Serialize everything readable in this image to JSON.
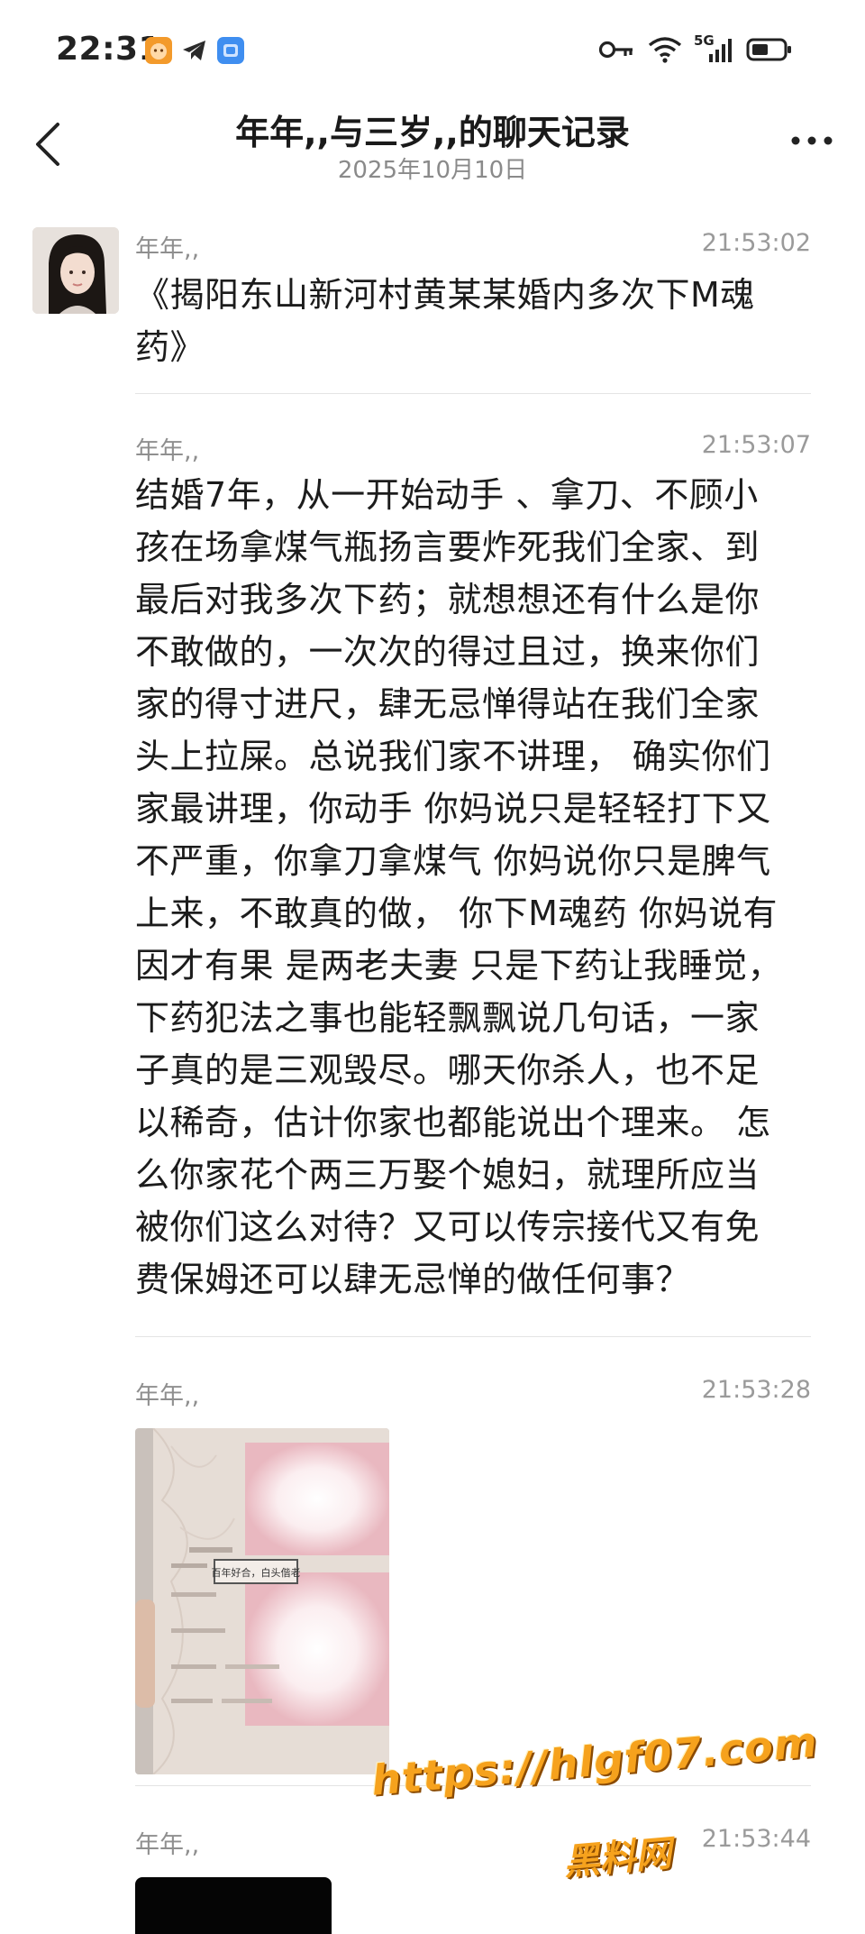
{
  "status_bar": {
    "time": "22:31",
    "notification_icons": [
      "cat-app-icon",
      "telegram-icon",
      "blue-app-icon"
    ],
    "system_icons": [
      "key-icon",
      "wifi-icon",
      "signal-5g-icon",
      "battery-icon"
    ],
    "network_label": "5G"
  },
  "header": {
    "title": "年年,,与三岁,,的聊天记录",
    "date": "2025年10月10日",
    "back_icon": "chevron-left-icon",
    "more_icon": "more-dots-icon"
  },
  "messages": [
    {
      "sender": "年年,,",
      "time": "21:53:02",
      "lines": [
        "《揭阳东山新河村黄某某婚内多次下M魂",
        "药》"
      ]
    },
    {
      "sender": "年年,,",
      "time": "21:53:07",
      "lines": [
        "结婚7年，从一开始动手 、拿刀、不顾小",
        "孩在场拿煤气瓶扬言要炸死我们全家、到",
        "最后对我多次下药；就想想还有什么是你",
        "不敢做的，一次次的得过且过，换来你们",
        "家的得寸进尺，肆无忌惮得站在我们全家",
        "头上拉屎。总说我们家不讲理， 确实你们",
        "家最讲理，你动手 你妈说只是轻轻打下又",
        "不严重，你拿刀拿煤气 你妈说你只是脾气",
        "上来，不敢真的做， 你下M魂药 你妈说有",
        "因才有果 是两老夫妻 只是下药让我睡觉，",
        "下药犯法之事也能轻飘飘说几句话，一家",
        "子真的是三观毁尽。哪天你杀人，也不足",
        "以稀奇，估计你家也都能说出个理来。 怎",
        "么你家花个两三万娶个媳妇，就理所应当",
        "被你们这么对待？又可以传宗接代又有免",
        "费保姆还可以肆无忌惮的做任何事？"
      ]
    },
    {
      "sender": "年年,,",
      "time": "21:53:28",
      "image": "marriage-certificate-photo",
      "image_caption": "百年好合，白头偕老"
    },
    {
      "sender": "年年,,",
      "time": "21:53:44",
      "image": "redacted-black-image"
    }
  ],
  "watermark": {
    "url": "https://hlgf07.com",
    "name": "黑料网"
  }
}
